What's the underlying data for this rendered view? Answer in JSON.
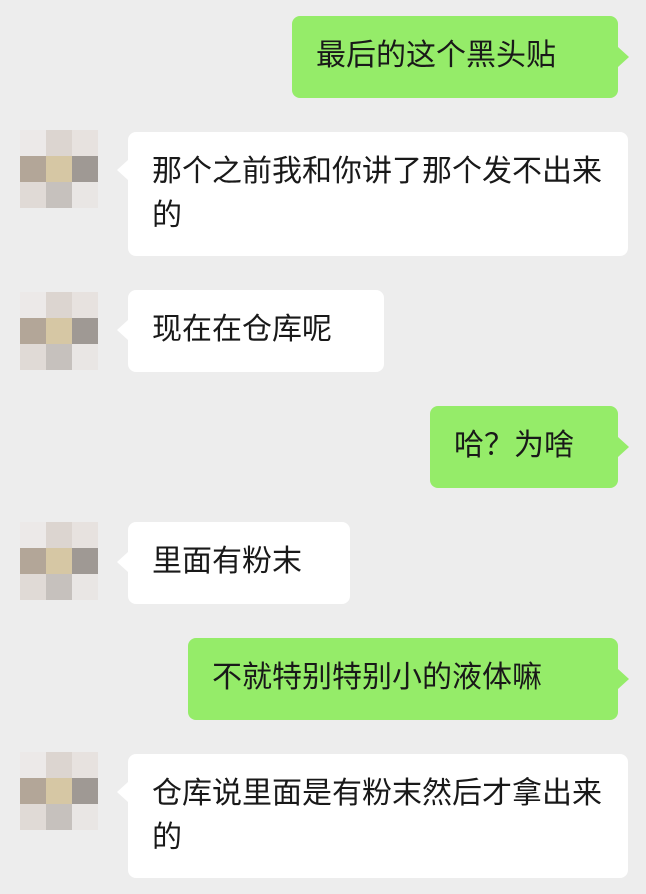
{
  "conversation": {
    "messages": [
      {
        "side": "right",
        "text": "最后的这个黑头贴"
      },
      {
        "side": "left",
        "text": "那个之前我和你讲了那个发不出来的"
      },
      {
        "side": "left",
        "text": "现在在仓库呢"
      },
      {
        "side": "right",
        "text": "哈？为啥"
      },
      {
        "side": "left",
        "text": "里面有粉末"
      },
      {
        "side": "right",
        "text": "不就特别特别小的液体嘛"
      },
      {
        "side": "left",
        "text": "仓库说里面是有粉末然后才拿出来的"
      }
    ]
  },
  "colors": {
    "background": "#ededed",
    "sent_bubble": "#95ec69",
    "received_bubble": "#ffffff",
    "text": "#191919"
  },
  "icons": {
    "avatar": "pixelated-avatar-icon"
  }
}
